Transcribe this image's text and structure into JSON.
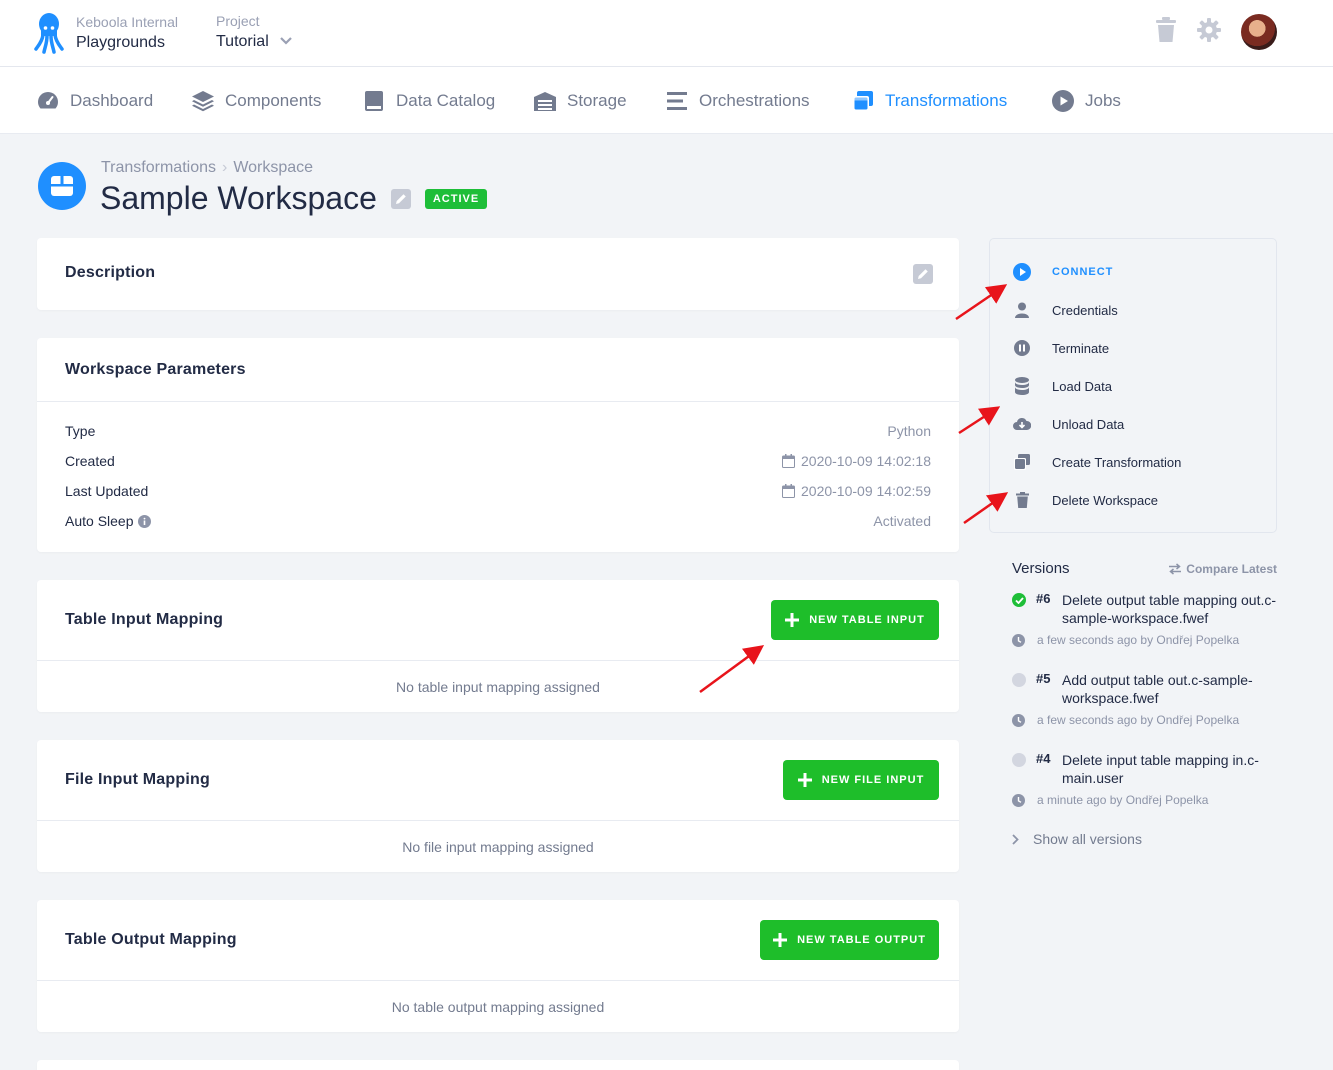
{
  "header": {
    "org_label": "Keboola Internal",
    "org_name": "Playgrounds",
    "project_label": "Project",
    "project_name": "Tutorial"
  },
  "nav": {
    "items": [
      {
        "label": "Dashboard",
        "icon": "dashboard-gauge-icon"
      },
      {
        "label": "Components",
        "icon": "layers-icon"
      },
      {
        "label": "Data Catalog",
        "icon": "book-icon"
      },
      {
        "label": "Storage",
        "icon": "warehouse-icon"
      },
      {
        "label": "Orchestrations",
        "icon": "bars-icon"
      },
      {
        "label": "Transformations",
        "icon": "windows-icon"
      },
      {
        "label": "Jobs",
        "icon": "play-circle-icon"
      }
    ],
    "active": "Transformations"
  },
  "page": {
    "breadcrumb": [
      "Transformations",
      "Workspace"
    ],
    "breadcrumb_sep": "›",
    "title": "Sample Workspace",
    "status_badge": "ACTIVE"
  },
  "description": {
    "title": "Description"
  },
  "parameters": {
    "title": "Workspace Parameters",
    "rows": [
      {
        "label": "Type",
        "value": "Python"
      },
      {
        "label": "Created",
        "value": "2020-10-09 14:02:18"
      },
      {
        "label": "Last Updated",
        "value": "2020-10-09 14:02:59"
      },
      {
        "label": "Auto Sleep",
        "value": "Activated"
      }
    ]
  },
  "table_input": {
    "title": "Table Input Mapping",
    "button": "NEW TABLE INPUT",
    "empty": "No table input mapping assigned"
  },
  "file_input": {
    "title": "File Input Mapping",
    "button": "NEW FILE INPUT",
    "empty": "No file input mapping assigned"
  },
  "table_output": {
    "title": "Table Output Mapping",
    "button": "NEW TABLE OUTPUT",
    "empty": "No table output mapping assigned"
  },
  "actions": [
    {
      "label": "CONNECT",
      "icon": "play-circle-icon"
    },
    {
      "label": "Credentials",
      "icon": "user-icon"
    },
    {
      "label": "Terminate",
      "icon": "pause-circle-icon"
    },
    {
      "label": "Load Data",
      "icon": "database-icon"
    },
    {
      "label": "Unload Data",
      "icon": "cloud-download-icon"
    },
    {
      "label": "Create Transformation",
      "icon": "windows-icon"
    },
    {
      "label": "Delete Workspace",
      "icon": "trash-icon"
    }
  ],
  "versions": {
    "title": "Versions",
    "compare": "Compare Latest",
    "items": [
      {
        "num": "#6",
        "text": "Delete output table mapping out.c-sample-workspace.fwef",
        "meta": "a few seconds ago by Ondřej Popelka",
        "status": "current"
      },
      {
        "num": "#5",
        "text": "Add output table out.c-sample-workspace.fwef",
        "meta": "a few seconds ago by Ondřej Popelka",
        "status": "past"
      },
      {
        "num": "#4",
        "text": "Delete input table mapping in.c-main.user",
        "meta": "a minute ago by Ondřej Popelka",
        "status": "past"
      }
    ],
    "show_all": "Show all versions"
  },
  "colors": {
    "accent": "#1f8fff",
    "success": "#1ebe2a",
    "annotation": "#e8141b"
  }
}
